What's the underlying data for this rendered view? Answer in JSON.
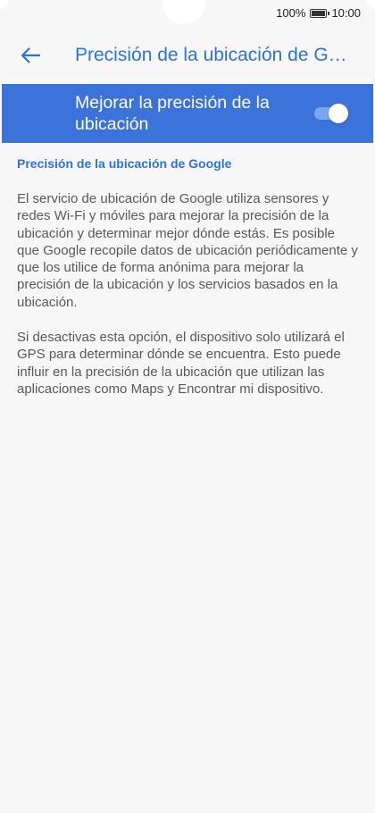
{
  "status_bar": {
    "battery_text": "100%",
    "time": "10:00"
  },
  "app_bar": {
    "title": "Precisión de la ubicación de Google",
    "back_icon": "arrow-left-icon"
  },
  "setting": {
    "label": "Mejorar la precisión de la ubicación",
    "toggle_on": true
  },
  "content": {
    "section_header": "Precisión de la ubicación de Google",
    "paragraph_1": "El servicio de ubicación de Google utiliza sensores y redes Wi-Fi y móviles para mejorar la precisión de la ubicación y determinar mejor dónde estás. Es posible que Google recopile datos de ubicación periódicamente y que los utilice de forma anónima para mejorar la precisión de la ubicación y los servicios basados en la ubicación.",
    "paragraph_2": "Si desactivas esta opción, el dispositivo solo utilizará el GPS para determinar dónde se encuentra. Esto puede influir en la precisión de la ubicación que utilizan las aplicaciones como Maps y Encontrar mi dispositivo."
  },
  "colors": {
    "accent": "#2f72d6",
    "highlight_row": "#3b73db",
    "background": "#f7f7f7",
    "body_text": "#595959"
  }
}
